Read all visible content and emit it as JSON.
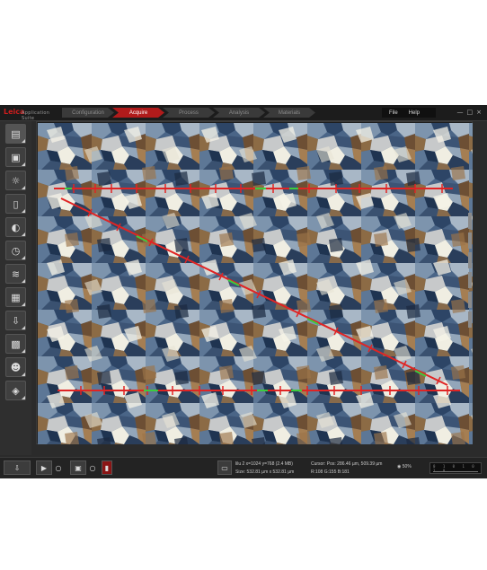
{
  "brand": {
    "logo_mark": "Leica",
    "logo_text": "Application Suite"
  },
  "tabs": [
    {
      "label": "Configuration",
      "active": false
    },
    {
      "label": "Acquire",
      "active": true
    },
    {
      "label": "Process",
      "active": false
    },
    {
      "label": "Analysis",
      "active": false
    },
    {
      "label": "Materials",
      "active": false
    }
  ],
  "menu": {
    "file": "File",
    "help": "Help"
  },
  "window_controls": {
    "minimize": "—",
    "maximize": "□",
    "close": "×"
  },
  "toolbar_icons": [
    "document-icon",
    "camera-icon",
    "light-icon",
    "cylinder-icon",
    "brightness-icon",
    "clock-icon",
    "layers-icon",
    "overlay-icon",
    "stage-icon",
    "chip-icon",
    "people-icon",
    "xyz-icon"
  ],
  "image_label": "micrograph with measurement lines",
  "status": {
    "image_line1": "lilu 2 x=1024 y=768 (2.4 MB)",
    "image_line2": "Size: 532.81 µm x 532.81 µm",
    "cursor_line1": "Cursor:  Pos: 286.46 µm, 509.39 µm",
    "cursor_line2": "R:108 G:155 B:181",
    "zoom": "50%",
    "ruler_scale": "0 1 0 1 0 1 0"
  },
  "accent_color": "#b01b1b",
  "measure_color": "#e02424",
  "intercept_color": "#3dcc3d"
}
